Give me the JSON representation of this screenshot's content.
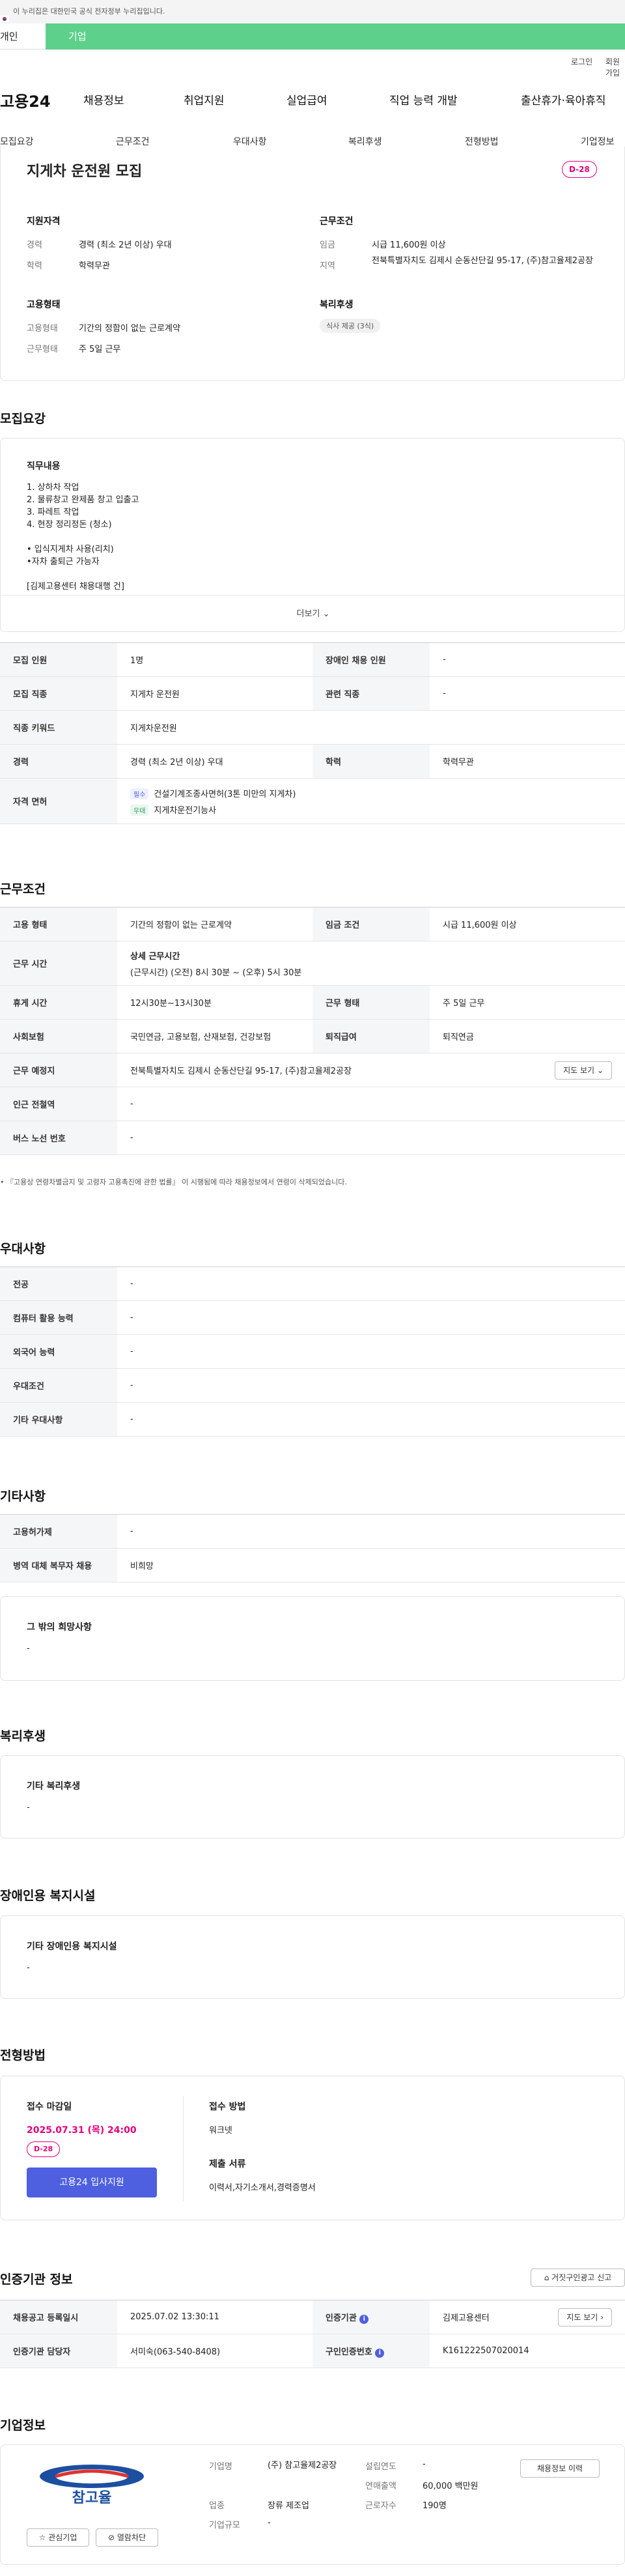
{
  "gov_banner": "이 누리집은 대한민국 공식 전자정부 누리집입니다.",
  "type_tabs": [
    "개인",
    "기업"
  ],
  "util": {
    "login": "로그인",
    "join": "회원가입"
  },
  "logo": "고용24",
  "nav": [
    "채용정보",
    "취업지원",
    "실업급여",
    "직업 능력 개발",
    "출산휴가·육아휴직"
  ],
  "sub_tabs": [
    "모집요강",
    "근무조건",
    "우대사항",
    "복리후생",
    "전형방법",
    "기업정보"
  ],
  "job": {
    "title": "지게차 운전원 모집",
    "dday": "D-28",
    "qual_title": "지원자격",
    "career_label": "경력",
    "career_value": "경력 (최소 2년 이상) 우대",
    "edu_label": "학력",
    "edu_value": "학력무관",
    "work_title": "근무조건",
    "wage_label": "임금",
    "wage_value": "시급 11,600원 이상",
    "region_label": "지역",
    "region_value": "전북특별자치도 김제시 순동산단길 95-17, (주)참고율제2공장",
    "emp_title": "고용형태",
    "emp_label": "고용형태",
    "emp_value": "기간의 정함이 없는 근로계약",
    "worktype_label": "근무형태",
    "worktype_value": "주 5일 근무",
    "welfare_title": "복리후생",
    "welfare_pill": "식사 제공 (3식)"
  },
  "recruit": {
    "title": "모집요강",
    "duty_title": "직무내용",
    "duty_lines": [
      "1. 상하차 작업",
      "2. 물류창고 완제품 창고 입출고",
      "3. 파레트 작업",
      "4. 현장 정리정돈 (청소)",
      "",
      "• 입식지게차 사용(리치)",
      "•자차 출퇴근 가능자",
      "",
      "[김제고용센터 채용대행 건]"
    ],
    "more": "더보기",
    "rows": [
      {
        "l1": "모집 인원",
        "v1": "1명",
        "l2": "장애인 채용 인원",
        "v2": "-"
      },
      {
        "l1": "모집 직종",
        "v1": "지게차 운전원",
        "l2": "관련 직종",
        "v2": "-"
      },
      {
        "l1": "직종 키워드",
        "v1": "지게차운전원"
      },
      {
        "l1": "경력",
        "v1": "경력 (최소 2년 이상) 우대",
        "l2": "학력",
        "v2": "학력무관"
      }
    ],
    "license_label": "자격 면허",
    "licenses": [
      {
        "tag": "필수",
        "name": "건설기계조종사면허(3톤 미만의 지게차)"
      },
      {
        "tag": "우대",
        "name": "지게차운전기능사"
      }
    ]
  },
  "work": {
    "title": "근무조건",
    "emp_type_l": "고용 형태",
    "emp_type_v": "기간의 정함이 없는 근로계약",
    "wage_l": "임금 조건",
    "wage_v": "시급 11,600원 이상",
    "hours_l": "근무 시간",
    "hours_title": "상세 근무시간",
    "hours_v": "(근무시간) (오전) 8시 30분 ~ (오후) 5시 30분",
    "break_l": "휴게 시간",
    "break_v": "12시30분~13시30분",
    "form_l": "근무 형태",
    "form_v": "주 5일 근무",
    "ins_l": "사회보험",
    "ins_v": "국민연금, 고용보험, 산재보험, 건강보험",
    "ret_l": "퇴직급여",
    "ret_v": "퇴직연금",
    "place_l": "근무 예정지",
    "place_v": "전북특별자치도 김제시 순동산단길 95-17, (주)참고율제2공장",
    "map_btn": "지도 보기",
    "subway_l": "인근 전철역",
    "subway_v": "-",
    "bus_l": "버스 노선 번호",
    "bus_v": "-",
    "note": "• 『고용상 연령차별금지 및 고령자 고용촉진에 관한 법률』 이 시행됨에 따라 채용정보에서 연령이 삭제되었습니다."
  },
  "pref": {
    "title": "우대사항",
    "rows": [
      {
        "l": "전공",
        "v": "-"
      },
      {
        "l": "컴퓨터 활용 능력",
        "v": "-"
      },
      {
        "l": "외국어 능력",
        "v": "-"
      },
      {
        "l": "우대조건",
        "v": "-"
      },
      {
        "l": "기타 우대사항",
        "v": "-"
      }
    ]
  },
  "etc": {
    "title": "기타사항",
    "rows": [
      {
        "l": "고용허가제",
        "v": "-"
      },
      {
        "l": "병역 대체 복무자 채용",
        "v": "비희망"
      }
    ],
    "wish_title": "그 밖의 희망사항",
    "wish_v": "-"
  },
  "welfare": {
    "title": "복리후생",
    "box_title": "기타 복리후생",
    "box_v": "-"
  },
  "disab": {
    "title": "장애인용 복지시설",
    "box_title": "기타 장애인용 복지시설",
    "box_v": "-"
  },
  "screening": {
    "title": "전형방법",
    "deadline_title": "접수 마감일",
    "deadline": "2025.07.31 (목) 24:00",
    "dday": "D-28",
    "apply": "고용24 입사지원",
    "method_title": "접수 방법",
    "method_v": "워크넷",
    "docs_title": "제출 서류",
    "docs_v": "이력서,자기소개서,경력증명서"
  },
  "cert": {
    "title": "인증기관 정보",
    "report_btn": "거짓구인광고 신고",
    "reg_l": "채용공고 등록일시",
    "reg_v": "2025.07.02 13:30:11",
    "org_l": "인증기관",
    "org_v": "김제고용센터",
    "map_btn": "지도 보기",
    "mgr_l": "인증기관 담당자",
    "mgr_v": "서미숙(063-540-8408)",
    "no_l": "구인인증번호",
    "no_v": "K161222507020014"
  },
  "company": {
    "title": "기업정보",
    "logo_text": "참고율",
    "interest_btn": "관심기업",
    "block_btn": "열람차단",
    "name_l": "기업명",
    "name_v": "(주) 참고율제2공장",
    "year_l": "설립연도",
    "year_v": "-",
    "ind_l": "업종",
    "ind_v": "장류 제조업",
    "sales_l": "연매출액",
    "sales_v": "60,000 백만원",
    "size_l": "기업규모",
    "size_v": "-",
    "emp_l": "근로자수",
    "emp_v": "190명",
    "history_btn": "채용정보 이력"
  },
  "colors": {
    "accent_green": "#5dd18b",
    "dday_pink": "#e4007f",
    "apply_blue": "#4e5fe0"
  }
}
